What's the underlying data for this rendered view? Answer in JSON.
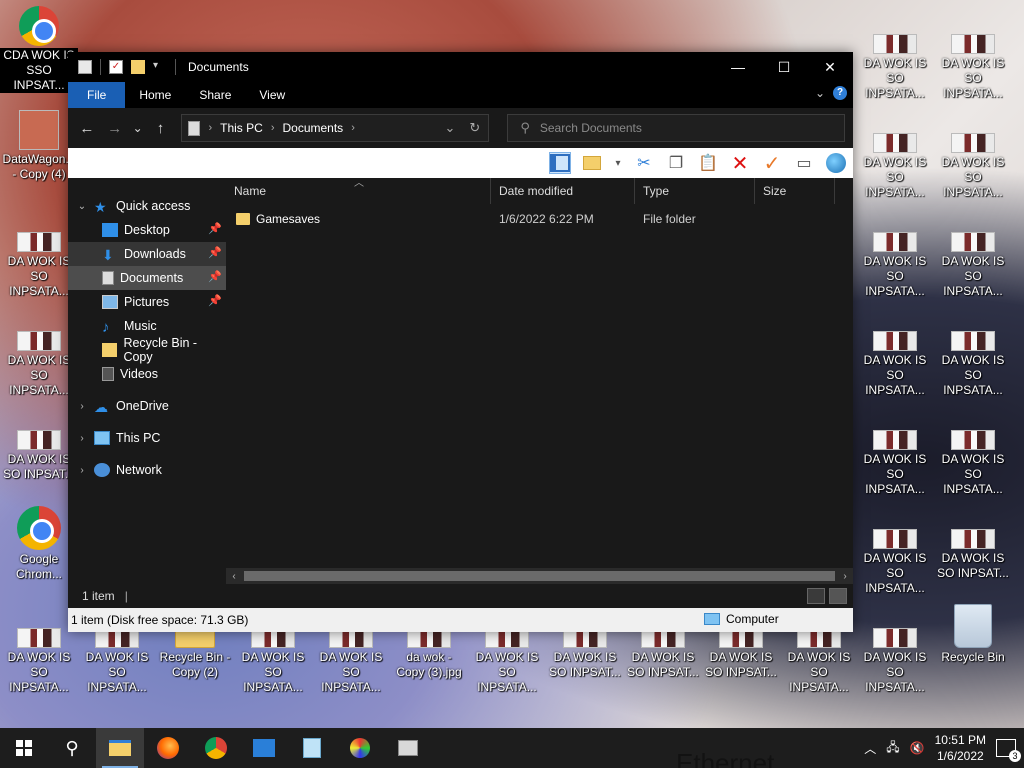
{
  "window": {
    "title": "Documents",
    "controls": {
      "minimize": "—",
      "maximize": "☐",
      "close": "✕"
    }
  },
  "ribbon": {
    "tabs": [
      "File",
      "Home",
      "Share",
      "View"
    ],
    "help": "?"
  },
  "navigation": {
    "back": "←",
    "forward": "→",
    "recent": "⌄",
    "up": "↑",
    "breadcrumb": [
      "This PC",
      "Documents"
    ],
    "refresh": "↻"
  },
  "search": {
    "placeholder": "Search Documents"
  },
  "sidebar": {
    "quick_access": "Quick access",
    "items": [
      {
        "label": "Desktop",
        "icon": "desktop-icon",
        "pinned": true
      },
      {
        "label": "Downloads",
        "icon": "downloads-icon",
        "pinned": true
      },
      {
        "label": "Documents",
        "icon": "documents-icon",
        "pinned": true
      },
      {
        "label": "Pictures",
        "icon": "pictures-icon",
        "pinned": true
      },
      {
        "label": "Music",
        "icon": "music-icon",
        "pinned": false
      },
      {
        "label": "Recycle Bin - Copy",
        "icon": "folder-icon",
        "pinned": false
      },
      {
        "label": "Videos",
        "icon": "videos-icon",
        "pinned": false
      }
    ],
    "onedrive": "OneDrive",
    "this_pc": "This PC",
    "network": "Network"
  },
  "file_list": {
    "columns": [
      "Name",
      "Date modified",
      "Type",
      "Size"
    ],
    "rows": [
      {
        "name": "Gamesaves",
        "date": "1/6/2022 6:22 PM",
        "type": "File folder",
        "size": ""
      }
    ]
  },
  "status": {
    "items": "1 item",
    "footer_left": "1 item (Disk free space: 71.3 GB)",
    "footer_right": "Computer"
  },
  "desktop_icons": {
    "wok": [
      "DA WOK IS",
      "SO INPSATA..."
    ],
    "wok_short": [
      "DA WOK IS",
      "SO INPSAT..."
    ],
    "datawagon": [
      "DataWagon...",
      "- Copy (4)"
    ],
    "chrome": [
      "Google",
      "Chrom..."
    ],
    "recycle_copy": [
      "Recycle Bin -",
      "Copy (2)"
    ],
    "dawok_jpg": [
      "da wok -",
      "Copy (3).jpg"
    ],
    "recycle_bin": "Recycle Bin",
    "top_left_label": [
      "CDA WOK IS",
      "SSO INPSAT..."
    ]
  },
  "taskbar": {
    "time": "10:51 PM",
    "date": "1/6/2022",
    "notifications": "3",
    "background_text": "Ethernet"
  }
}
